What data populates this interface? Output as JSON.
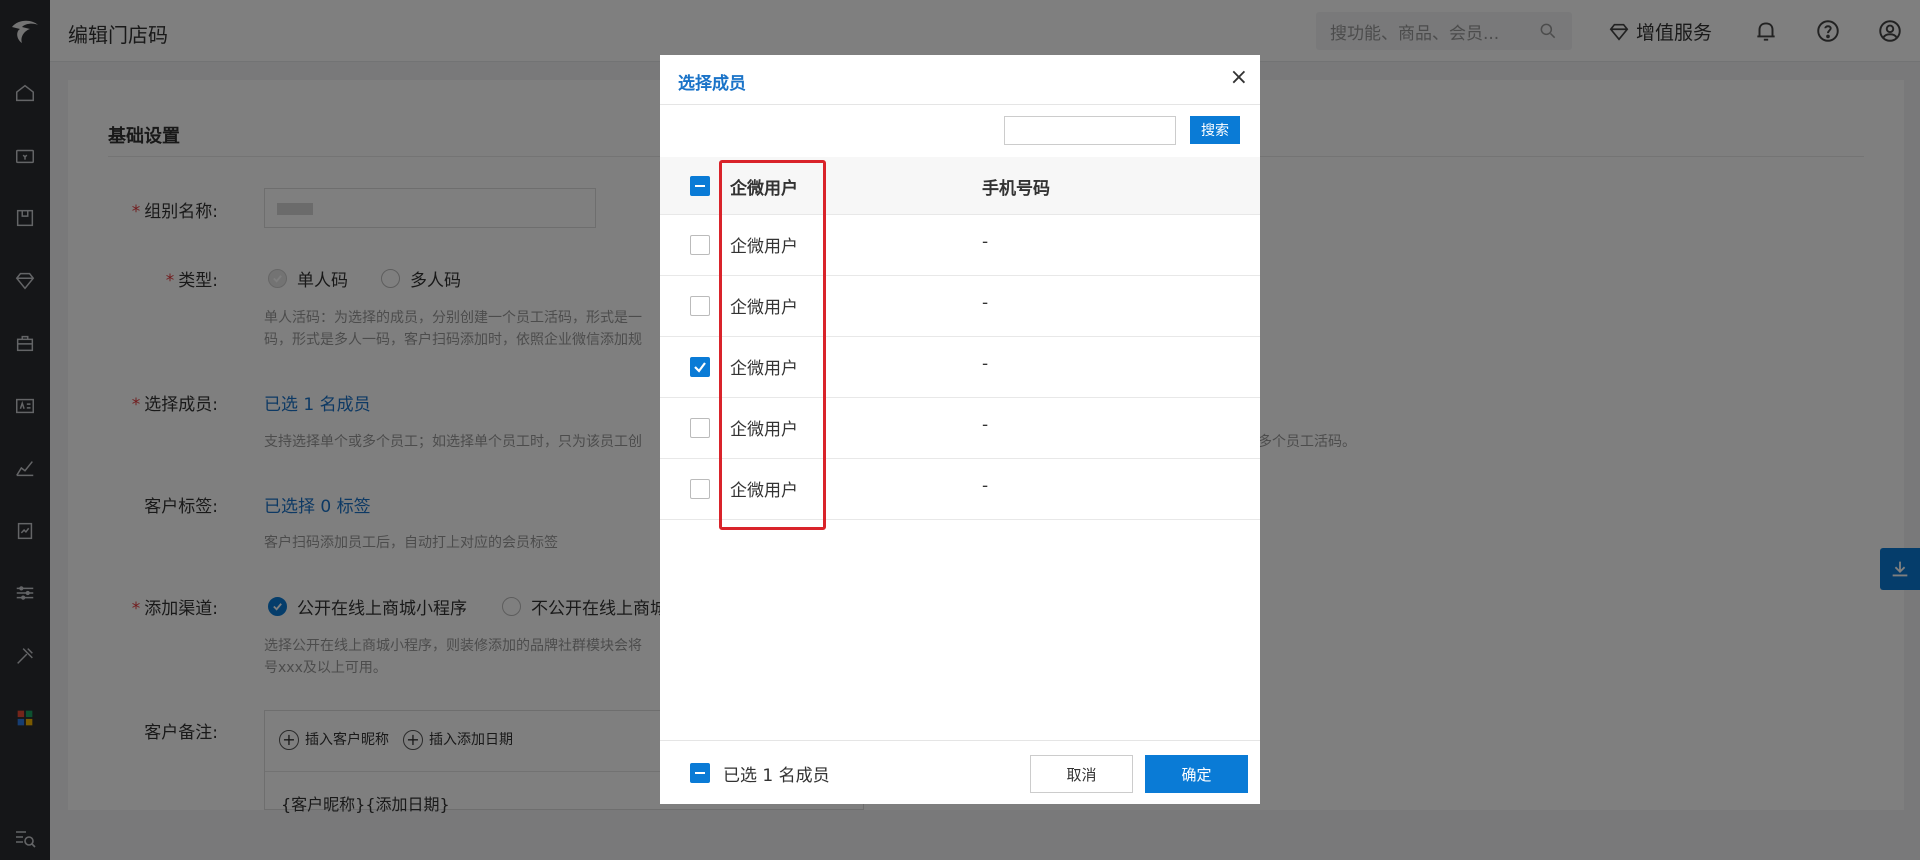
{
  "topbar": {
    "title": "编辑门店码",
    "search_placeholder": "搜功能、商品、会员...",
    "value_added": "增值服务"
  },
  "form": {
    "section_title": "基础设置",
    "group_name_label": "组别名称:",
    "type_label": "类型:",
    "type_single": "单人码",
    "type_multi": "多人码",
    "type_help_1": "单人活码：为选择的成员，分别创建一个员工活码，形式是一",
    "type_help_2": "码，形式是多人一码，客户扫码添加时，依照企业微信添加规",
    "members_label": "选择成员:",
    "members_link": "已选 1 名成员",
    "members_help_left": "支持选择单个或多个员工；如选择单个员工时，只为该员工创",
    "members_help_right": "多个员工活码。",
    "tags_label": "客户标签:",
    "tags_link": "已选择 0 标签",
    "tags_help": "客户扫码添加员工后，自动打上对应的会员标签",
    "channel_label": "添加渠道:",
    "channel_public": "公开在线上商城小程序",
    "channel_private": "不公开在线上商城",
    "channel_help_1": "选择公开在线上商城小程序，则装修添加的品牌社群模块会将",
    "channel_help_2": "号xxx及以上可用。",
    "remark_label": "客户备注:",
    "insert_nickname": "插入客户昵称",
    "insert_date": "插入添加日期",
    "remark_content": "{客户昵称}{添加日期}"
  },
  "modal": {
    "title": "选择成员",
    "close": "×",
    "search_button": "搜索",
    "col_user": "企微用户",
    "col_phone": "手机号码",
    "rows": [
      {
        "user": "企微用户",
        "phone": "-",
        "checked": false
      },
      {
        "user": "企微用户",
        "phone": "-",
        "checked": false
      },
      {
        "user": "企微用户",
        "phone": "-",
        "checked": true
      },
      {
        "user": "企微用户",
        "phone": "-",
        "checked": false
      },
      {
        "user": "企微用户",
        "phone": "-",
        "checked": false
      }
    ],
    "footer_selected": "已选 1 名成员",
    "cancel": "取消",
    "confirm": "确定"
  },
  "colors": {
    "accent": "#0a7bd6",
    "highlight": "#d9232a",
    "sidebar": "#2b2d30"
  }
}
